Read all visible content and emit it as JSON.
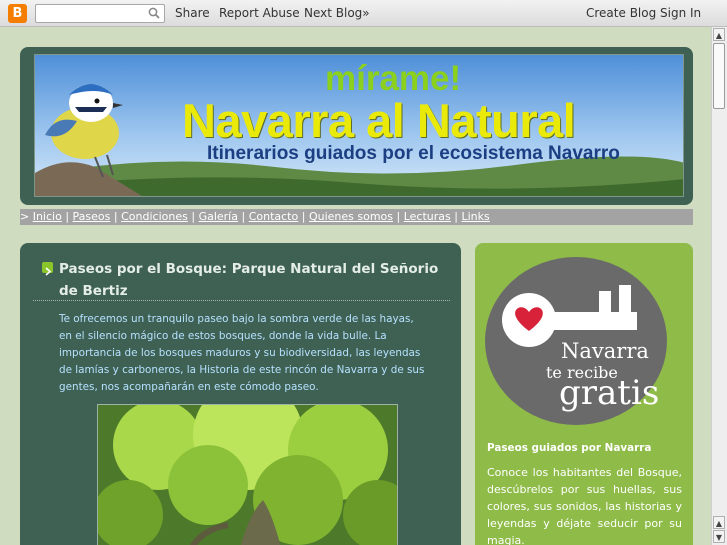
{
  "navbar": {
    "logo_letter": "B",
    "search_placeholder": "",
    "links": {
      "share": "Share",
      "report": "Report Abuse",
      "next": "Next Blog»"
    },
    "right_links": {
      "create": "Create Blog",
      "signin": "Sign In"
    }
  },
  "header": {
    "tagline_top": "mírame!",
    "title": "Navarra al Natural",
    "subtitle": "Itinerarios guiados por el ecosistema Navarro"
  },
  "menu": {
    "prefix": ">",
    "items": [
      "Inicio",
      "Paseos",
      "Condiciones",
      "Galería",
      "Contacto",
      "Quienes somos",
      "Lecturas",
      "Links"
    ]
  },
  "post": {
    "title": "Paseos por el Bosque: Parque Natural del Señorio de Bertiz",
    "body": "Te ofrecemos un tranquilo paseo bajo la sombra verde de las hayas, en el silencio mágico de estos bosques, donde la vida bulle. La importancia de los bosques maduros y su biodiversidad, las leyendas de lamías y carboneros, la Historia de este rincón de Navarra y de sus gentes, nos acompañarán en este cómodo paseo."
  },
  "sidebar": {
    "badge": {
      "line1": "Navarra",
      "line2": "te recibe",
      "line3": "gratis"
    },
    "heading": "Paseos guiados por Navarra",
    "text": "Conoce los habitantes del Bosque, descúbrelos por sus huellas, sus colores, sus sonidos, las historias y leyendas y déjate seducir por su magia."
  },
  "colors": {
    "page_bg": "#cfdcc0",
    "main_panel": "#3e6153",
    "sidebar_panel": "#8fbb49",
    "title_yellow": "#eaea0a",
    "link_blue": "#b6e1ff"
  }
}
